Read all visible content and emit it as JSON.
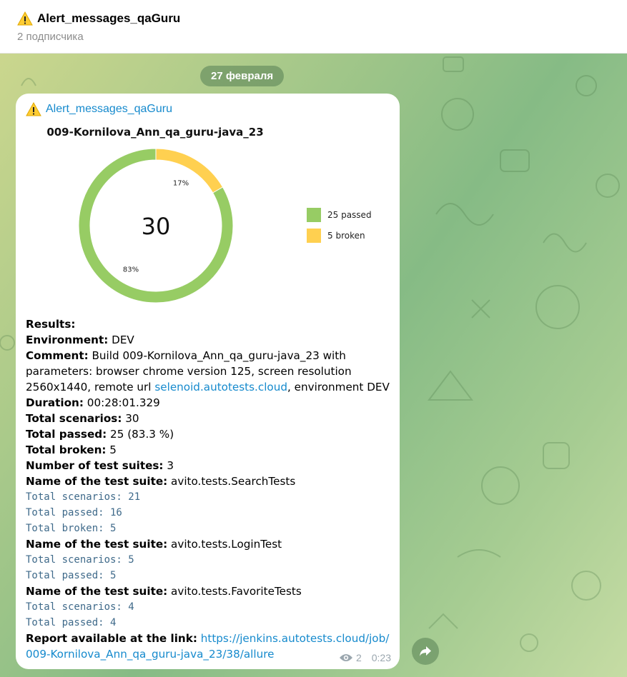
{
  "header": {
    "title": "Alert_messages_qaGuru",
    "subtitle": "2 подписчика"
  },
  "date_pill": "27 февраля",
  "message": {
    "sender": "Alert_messages_qaGuru",
    "views": "2",
    "time": "0:23",
    "lines": {
      "results": "Results:",
      "env_label": "Environment:",
      "env_value": " DEV",
      "comment_label": "Comment:",
      "comment_value": " Build 009-Kornilova_Ann_qa_guru-java_23 with parameters: browser chrome version 125, screen resolution 2560x1440, remote url ",
      "comment_link": "selenoid.autotests.cloud",
      "comment_tail": ", environment DEV",
      "duration_label": "Duration:",
      "duration_value": " 00:28:01.329",
      "total_label": "Total scenarios:",
      "total_value": " 30",
      "passed_label": "Total passed:",
      "passed_value": " 25 (83.3 %)",
      "broken_label": "Total broken:",
      "broken_value": " 5",
      "suites_label": "Number of test suites:",
      "suites_value": " 3",
      "suite_label": "Name of the test suite:",
      "suite1_name": " avito.tests.SearchTests",
      "suite1_total": "Total scenarios: 21",
      "suite1_passed": "Total passed: 16",
      "suite1_broken": "Total broken: 5",
      "suite2_name": " avito.tests.LoginTest",
      "suite2_total": "Total scenarios: 5",
      "suite2_passed": "Total passed: 5",
      "suite3_name": " avito.tests.FavoriteTests",
      "suite3_total": "Total scenarios: 4",
      "suite3_passed": "Total passed: 4",
      "report_label": "Report available at the link:",
      "report_link": " https://jenkins.autotests.cloud/job/009-Kornilova_Ann_qa_guru-java_23/38/allure"
    }
  },
  "chart_data": {
    "type": "pie",
    "title": "009-Kornilova_Ann_qa_guru-java_23",
    "center_label": "30",
    "slices": [
      {
        "name": "25 passed",
        "value": 25,
        "percent_label": "83%",
        "color": "#97cc64"
      },
      {
        "name": "5 broken",
        "value": 5,
        "percent_label": "17%",
        "color": "#ffd050"
      }
    ],
    "legend_position": "right"
  },
  "colors": {
    "accent": "#168acd",
    "passed": "#97cc64",
    "broken": "#ffd050"
  },
  "icons": {
    "warning": "warning-icon",
    "views": "eye-icon",
    "forward": "forward-arrow-icon"
  }
}
